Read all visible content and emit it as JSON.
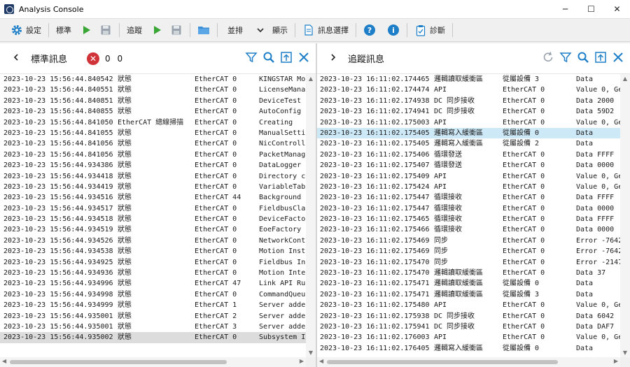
{
  "window": {
    "title": "Analysis Console",
    "minimize": "─",
    "maximize": "☐",
    "close": "✕"
  },
  "toolbar": {
    "settings_label": "設定",
    "standard_label": "標準",
    "trace_label": "追蹤",
    "tile_label": "並排",
    "display_label": "顯示",
    "message_select_label": "訊息選擇",
    "diagnose_label": "診斷"
  },
  "colors": {
    "accent_blue": "#1e7fc8",
    "play_green": "#3aa635",
    "error_red": "#d13438",
    "folder_blue": "#3d8fd6"
  },
  "left_panel": {
    "title": "標準訊息",
    "error_count": "0 0",
    "rows": [
      {
        "time": "2023-10-23 15:56:44.840542",
        "type": "狀態",
        "source": "EtherCAT 0",
        "message": "KINGSTAR Mo"
      },
      {
        "time": "2023-10-23 15:56:44.840551",
        "type": "狀態",
        "source": "EtherCAT 0",
        "message": "LicenseMana"
      },
      {
        "time": "2023-10-23 15:56:44.840851",
        "type": "狀態",
        "source": "EtherCAT 0",
        "message": "DeviceTest"
      },
      {
        "time": "2023-10-23 15:56:44.840855",
        "type": "狀態",
        "source": "EtherCAT 0",
        "message": "AutoConfig"
      },
      {
        "time": "2023-10-23 15:56:44.841050",
        "type": "EtherCAT 總線掃描",
        "source": " EtherCAT 0",
        "message": " Creating"
      },
      {
        "time": "2023-10-23 15:56:44.841055",
        "type": "狀態",
        "source": "EtherCAT 0",
        "message": "ManualSetti"
      },
      {
        "time": "2023-10-23 15:56:44.841056",
        "type": "狀態",
        "source": "EtherCAT 0",
        "message": "NicControll"
      },
      {
        "time": "2023-10-23 15:56:44.841056",
        "type": "狀態",
        "source": "EtherCAT 0",
        "message": "PacketManag"
      },
      {
        "time": "2023-10-23 15:56:44.934386",
        "type": "狀態",
        "source": "EtherCAT 0",
        "message": "DataLogger"
      },
      {
        "time": "2023-10-23 15:56:44.934418",
        "type": "狀態",
        "source": "EtherCAT 0",
        "message": "Directory c"
      },
      {
        "time": "2023-10-23 15:56:44.934419",
        "type": "狀態",
        "source": "EtherCAT 0",
        "message": "VariableTab"
      },
      {
        "time": "2023-10-23 15:56:44.934516",
        "type": "狀態",
        "source": "EtherCAT 44",
        "message": "Background"
      },
      {
        "time": "2023-10-23 15:56:44.934517",
        "type": "狀態",
        "source": "EtherCAT 0",
        "message": "FieldbusCla"
      },
      {
        "time": "2023-10-23 15:56:44.934518",
        "type": "狀態",
        "source": "EtherCAT 0",
        "message": "DeviceFacto"
      },
      {
        "time": "2023-10-23 15:56:44.934519",
        "type": "狀態",
        "source": "EtherCAT 0",
        "message": "EoeFactory"
      },
      {
        "time": "2023-10-23 15:56:44.934526",
        "type": "狀態",
        "source": "EtherCAT 0",
        "message": "NetworkCont"
      },
      {
        "time": "2023-10-23 15:56:44.934538",
        "type": "狀態",
        "source": "EtherCAT 0",
        "message": "Motion Inst"
      },
      {
        "time": "2023-10-23 15:56:44.934925",
        "type": "狀態",
        "source": "EtherCAT 0",
        "message": "Fieldbus In"
      },
      {
        "time": "2023-10-23 15:56:44.934936",
        "type": "狀態",
        "source": "EtherCAT 0",
        "message": "Motion Inte"
      },
      {
        "time": "2023-10-23 15:56:44.934996",
        "type": "狀態",
        "source": "EtherCAT 47",
        "message": "Link API Ru"
      },
      {
        "time": "2023-10-23 15:56:44.934998",
        "type": "狀態",
        "source": "EtherCAT 0",
        "message": "CommandQueu"
      },
      {
        "time": "2023-10-23 15:56:44.934999",
        "type": "狀態",
        "source": "EtherCAT 1",
        "message": "Server adde"
      },
      {
        "time": "2023-10-23 15:56:44.935001",
        "type": "狀態",
        "source": "EtherCAT 2",
        "message": "Server adde"
      },
      {
        "time": "2023-10-23 15:56:44.935001",
        "type": "狀態",
        "source": "EtherCAT 3",
        "message": "Server adde"
      },
      {
        "time": "2023-10-23 15:56:44.935002",
        "type": "狀態",
        "source": "EtherCAT 0",
        "message": "Subsystem I"
      }
    ]
  },
  "right_panel": {
    "title": "追蹤訊息",
    "rows": [
      {
        "time": "2023-10-23 16:11:02.174465",
        "type": "邏輯讀取緩衝區",
        "source": "      從屬設備 3",
        "message": "Data"
      },
      {
        "time": "2023-10-23 16:11:02.174474",
        "type": "API",
        "source": "EtherCAT 0",
        "message": "Value 0, GetS"
      },
      {
        "time": "2023-10-23 16:11:02.174938",
        "type": "DC 同步接收",
        "source": "  EtherCAT 0",
        "message": "Data 2000"
      },
      {
        "time": "2023-10-23 16:11:02.174941",
        "type": "DC 同步接收",
        "source": "  EtherCAT 0",
        "message": "Data 59D2"
      },
      {
        "time": "2023-10-23 16:11:02.175003",
        "type": "API",
        "source": "EtherCAT 0",
        "message": "Value 0, GetS"
      },
      {
        "time": "2023-10-23 16:11:02.175405",
        "type": "邏輯寫入緩衝區",
        "source": "      從屬設備 0",
        "message": "Data"
      },
      {
        "time": "2023-10-23 16:11:02.175405",
        "type": "邏輯寫入緩衝區",
        "source": "      從屬設備 2",
        "message": "Data"
      },
      {
        "time": "2023-10-23 16:11:02.175406",
        "type": "循環發送",
        "source": "  EtherCAT 0",
        "message": "Data FFFF"
      },
      {
        "time": "2023-10-23 16:11:02.175407",
        "type": "循環發送",
        "source": "  EtherCAT 0",
        "message": "Data 0000"
      },
      {
        "time": "2023-10-23 16:11:02.175409",
        "type": "API",
        "source": "EtherCAT 0",
        "message": "Value 0, GetS"
      },
      {
        "time": "2023-10-23 16:11:02.175424",
        "type": "API",
        "source": "EtherCAT 0",
        "message": "Value 0, GetS"
      },
      {
        "time": "2023-10-23 16:11:02.175447",
        "type": "循環接收",
        "source": "  EtherCAT 0",
        "message": "Data FFFF"
      },
      {
        "time": "2023-10-23 16:11:02.175447",
        "type": "循環接收",
        "source": "  EtherCAT 0",
        "message": "Data 0000"
      },
      {
        "time": "2023-10-23 16:11:02.175465",
        "type": "循環接收",
        "source": "  EtherCAT 0",
        "message": "Data FFFF"
      },
      {
        "time": "2023-10-23 16:11:02.175466",
        "type": "循環接收",
        "source": "  EtherCAT 0",
        "message": "Data 0000"
      },
      {
        "time": "2023-10-23 16:11:02.175469",
        "type": "同步",
        "source": " EtherCAT 0",
        "message": "Error -7642"
      },
      {
        "time": "2023-10-23 16:11:02.175469",
        "type": "同步",
        "source": " EtherCAT 0",
        "message": "Error -7642"
      },
      {
        "time": "2023-10-23 16:11:02.175470",
        "type": "同步",
        "source": " EtherCAT 0",
        "message": "Error -2147"
      },
      {
        "time": "2023-10-23 16:11:02.175470",
        "type": "邏輯讀取緩衝區",
        "source": "   EtherCAT 0",
        "message": "Data 37"
      },
      {
        "time": "2023-10-23 16:11:02.175471",
        "type": "邏輯讀取緩衝區",
        "source": "      從屬設備 0",
        "message": "Data"
      },
      {
        "time": "2023-10-23 16:11:02.175471",
        "type": "邏輯讀取緩衝區",
        "source": "      從屬設備 3",
        "message": "Data"
      },
      {
        "time": "2023-10-23 16:11:02.175480",
        "type": "API",
        "source": "EtherCAT 0",
        "message": "Value 0, GetS"
      },
      {
        "time": "2023-10-23 16:11:02.175938",
        "type": "DC 同步接收",
        "source": "  EtherCAT 0",
        "message": "Data 6042"
      },
      {
        "time": "2023-10-23 16:11:02.175941",
        "type": "DC 同步接收",
        "source": "  EtherCAT 0",
        "message": "Data DAF7"
      },
      {
        "time": "2023-10-23 16:11:02.176003",
        "type": "API",
        "source": "EtherCAT 0",
        "message": "Value 0, GetS"
      },
      {
        "time": "2023-10-23 16:11:02.176405",
        "type": "邏輯寫入緩衝區",
        "source": "      從屬設備 0",
        "message": "Data"
      }
    ]
  }
}
